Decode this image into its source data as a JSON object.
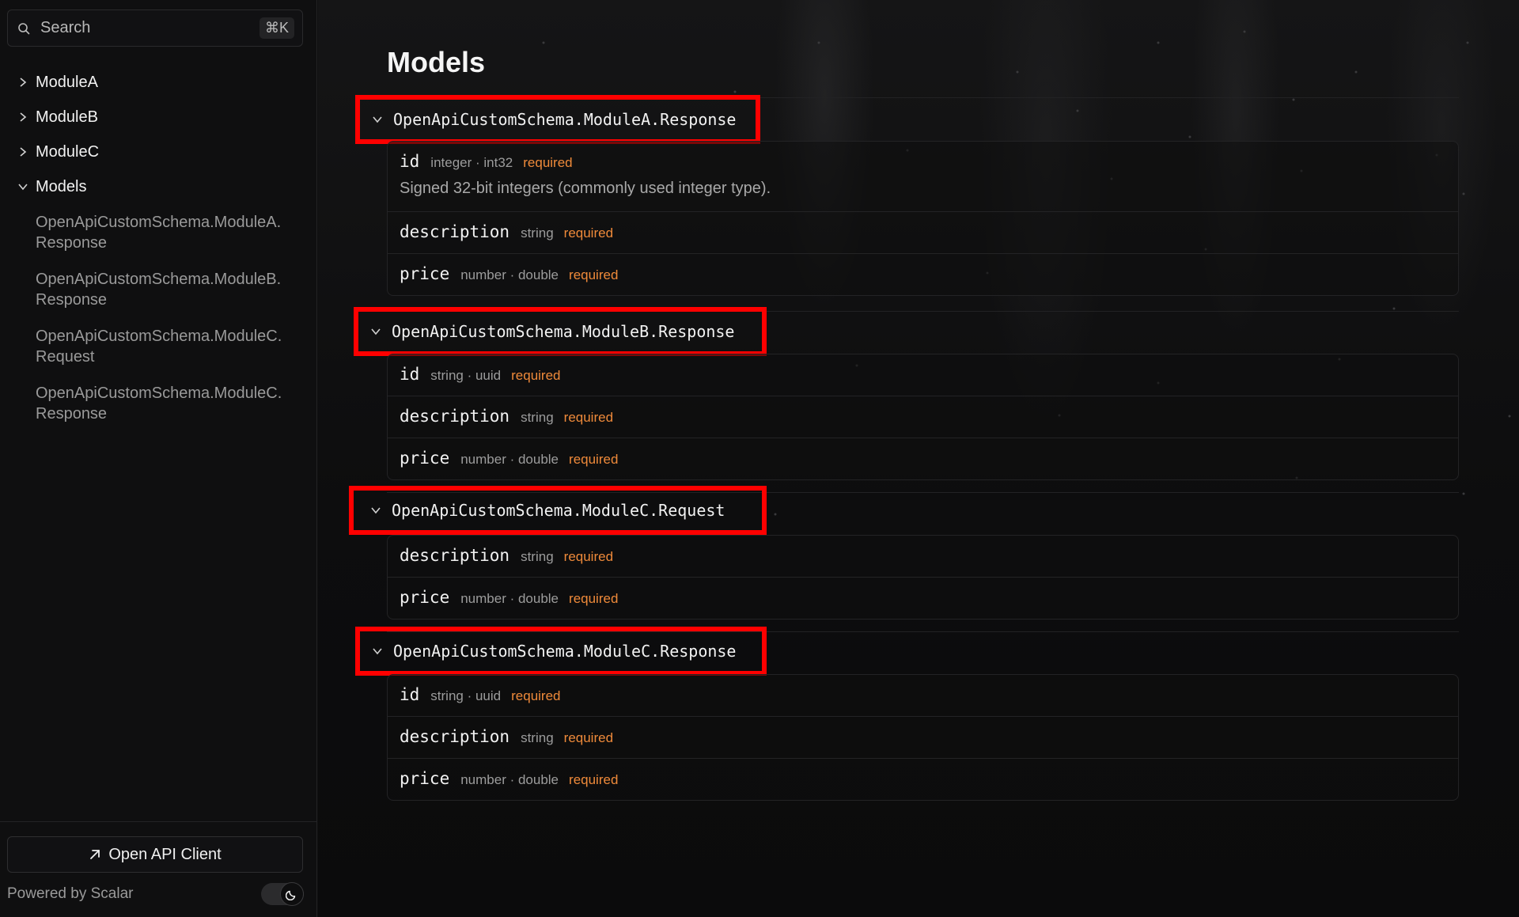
{
  "sidebar": {
    "search": {
      "placeholder": "Search",
      "shortcut": "⌘K"
    },
    "nav": [
      {
        "label": "ModuleA",
        "expanded": false
      },
      {
        "label": "ModuleB",
        "expanded": false
      },
      {
        "label": "ModuleC",
        "expanded": false
      },
      {
        "label": "Models",
        "expanded": true
      }
    ],
    "model_links": [
      {
        "line1": "OpenApiCustomSchema.ModuleA.",
        "line2": "Response"
      },
      {
        "line1": "OpenApiCustomSchema.ModuleB.",
        "line2": "Response"
      },
      {
        "line1": "OpenApiCustomSchema.ModuleC.",
        "line2": "Request"
      },
      {
        "line1": "OpenApiCustomSchema.ModuleC.",
        "line2": "Response"
      }
    ],
    "open_client_label": "Open API Client",
    "powered_by": "Powered by Scalar",
    "theme": "dark"
  },
  "main": {
    "title": "Models",
    "models": [
      {
        "name": "OpenApiCustomSchema.ModuleA.Response",
        "properties": [
          {
            "name": "id",
            "type": "integer · int32",
            "required": "required",
            "description": "Signed 32-bit integers (commonly used integer type)."
          },
          {
            "name": "description",
            "type": "string",
            "required": "required"
          },
          {
            "name": "price",
            "type": "number · double",
            "required": "required"
          }
        ]
      },
      {
        "name": "OpenApiCustomSchema.ModuleB.Response",
        "properties": [
          {
            "name": "id",
            "type": "string · uuid",
            "required": "required"
          },
          {
            "name": "description",
            "type": "string",
            "required": "required"
          },
          {
            "name": "price",
            "type": "number · double",
            "required": "required"
          }
        ]
      },
      {
        "name": "OpenApiCustomSchema.ModuleC.Request",
        "properties": [
          {
            "name": "description",
            "type": "string",
            "required": "required"
          },
          {
            "name": "price",
            "type": "number · double",
            "required": "required"
          }
        ]
      },
      {
        "name": "OpenApiCustomSchema.ModuleC.Response",
        "properties": [
          {
            "name": "id",
            "type": "string · uuid",
            "required": "required"
          },
          {
            "name": "description",
            "type": "string",
            "required": "required"
          },
          {
            "name": "price",
            "type": "number · double",
            "required": "required"
          }
        ]
      }
    ]
  },
  "colors": {
    "highlight_border": "#ff0000",
    "required": "#ef8a3a",
    "background": "#0e0e0f"
  }
}
